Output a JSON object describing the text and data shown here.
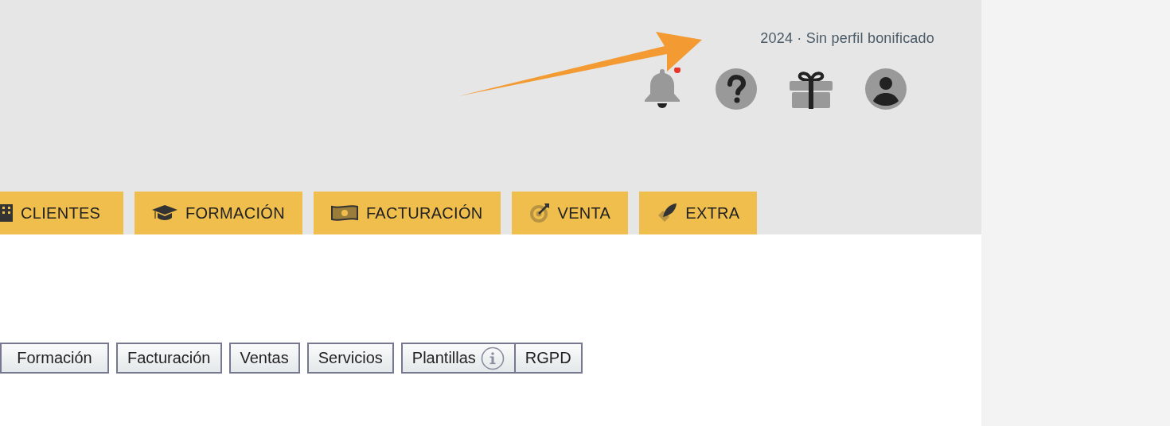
{
  "header": {
    "status_text": "2024 · Sin perfil bonificado",
    "notifications": {
      "has_unread": true
    }
  },
  "nav_tabs": [
    {
      "label": "CLIENTES"
    },
    {
      "label": "FORMACIÓN"
    },
    {
      "label": "FACTURACIÓN"
    },
    {
      "label": "VENTA"
    },
    {
      "label": "EXTRA"
    }
  ],
  "sub_tabs": [
    {
      "label": "Formación",
      "info": false
    },
    {
      "label": "Facturación",
      "info": false
    },
    {
      "label": "Ventas",
      "info": false
    },
    {
      "label": "Servicios",
      "info": false
    },
    {
      "label": "Plantillas",
      "info": true
    },
    {
      "label": "RGPD",
      "info": false
    }
  ]
}
